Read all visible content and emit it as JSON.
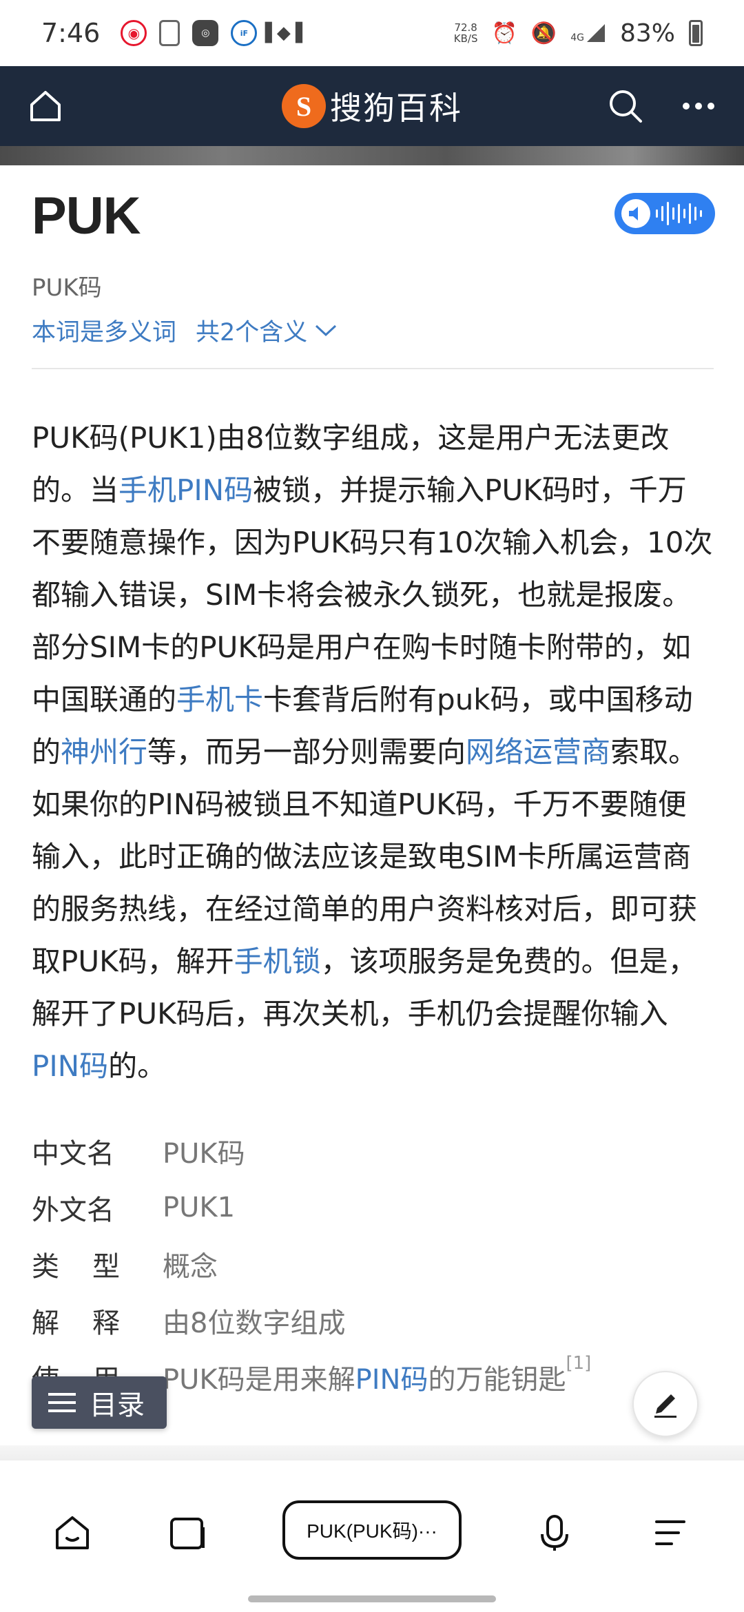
{
  "status_bar": {
    "time": "7:46",
    "net_speed_value": "72.8",
    "net_speed_unit": "KB/S",
    "signal_label": "4G",
    "battery": "83%"
  },
  "header": {
    "logo_text": "搜狗百科"
  },
  "article": {
    "title": "PUK",
    "subtitle": "PUK码",
    "polysemy_label": "本词是多义词",
    "polysemy_count": "共2个含义",
    "paragraph": [
      {
        "text": "PUK码(PUK1)由8位数字组成，这是用户无法更改的。当"
      },
      {
        "text": "手机PIN码",
        "link": true
      },
      {
        "text": "被锁，并提示输入PUK码时，千万不要随意操作，因为PUK码只有10次输入机会，10次都输入错误，SIM卡将会被永久锁死，也就是报废。部分SIM卡的PUK码是用户在购卡时随卡附带的，如中国联通的"
      },
      {
        "text": "手机卡",
        "link": true
      },
      {
        "text": "卡套背后附有puk码，或中国移动的"
      },
      {
        "text": "神州行",
        "link": true
      },
      {
        "text": "等，而另一部分则需要向"
      },
      {
        "text": "网络运营商",
        "link": true
      },
      {
        "text": "索取。如果你的PIN码被锁且不知道PUK码，千万不要随便输入，此时正确的做法应该是致电SIM卡所属运营商的服务热线，在经过简单的用户资料核对后，即可获取PUK码，解开"
      },
      {
        "text": "手机锁",
        "link": true
      },
      {
        "text": "，该项服务是免费的。但是，解开了PUK码后，再次关机，手机仍会提醒你输入"
      },
      {
        "text": "PIN码",
        "link": true
      },
      {
        "text": "的。"
      }
    ],
    "info": [
      {
        "key": "中文名",
        "value": "PUK码"
      },
      {
        "key": "外文名",
        "value": "PUK1"
      },
      {
        "key": "类型",
        "value": "概念"
      },
      {
        "key": "解释",
        "value": "由8位数字组成"
      },
      {
        "key": "使用",
        "value_before": "PUK码是用来解",
        "value_link": "PIN码",
        "value_after": "的万能钥匙",
        "ref": "[1]"
      }
    ]
  },
  "toc_button": {
    "label": "目录"
  },
  "bottom_bar": {
    "address_text": "PUK(PUK码)···"
  },
  "colors": {
    "header_bg": "#1e2a3d",
    "brand_orange": "#ef6b1d",
    "link_blue": "#3e7bc2",
    "voice_blue": "#2f80f1"
  },
  "icons": [
    "home-icon",
    "search-icon",
    "more-icon",
    "speaker-icon",
    "toc-menu-icon",
    "edit-pencil-icon",
    "home-smile-icon",
    "tabs-icon",
    "microphone-icon",
    "menu-lines-icon"
  ]
}
